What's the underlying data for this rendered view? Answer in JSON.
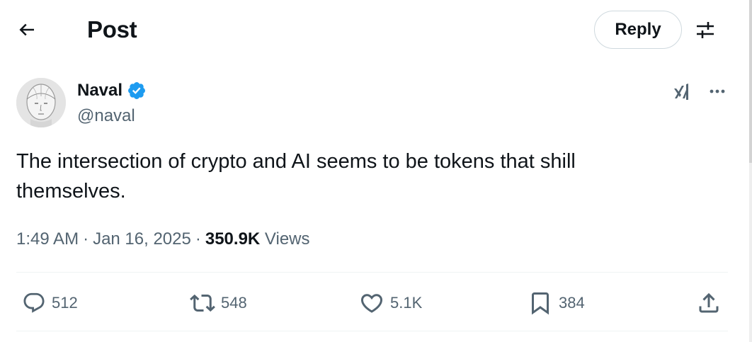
{
  "header": {
    "title": "Post",
    "reply_label": "Reply"
  },
  "author": {
    "name": "Naval",
    "handle": "@naval",
    "verified": true,
    "verified_color": "#1d9bf0"
  },
  "tweet": {
    "text": "The intersection of crypto and AI seems to be tokens that shill themselves.",
    "time": "1:49 AM",
    "date": "Jan 16, 2025",
    "views_count": "350.9K",
    "views_label": "Views"
  },
  "actions": {
    "replies": "512",
    "reposts": "548",
    "likes": "5.1K",
    "bookmarks": "384"
  },
  "icons": {
    "back": "arrow-left-icon",
    "settings": "sliders-icon",
    "grok": "grok-icon",
    "more": "more-horizontal-icon",
    "reply": "speech-bubble-icon",
    "repost": "repost-icon",
    "like": "heart-icon",
    "bookmark": "bookmark-icon",
    "share": "share-icon"
  },
  "colors": {
    "text_primary": "#0f1419",
    "text_secondary": "#536471",
    "border": "#cfd9de",
    "divider": "#eff3f4"
  }
}
